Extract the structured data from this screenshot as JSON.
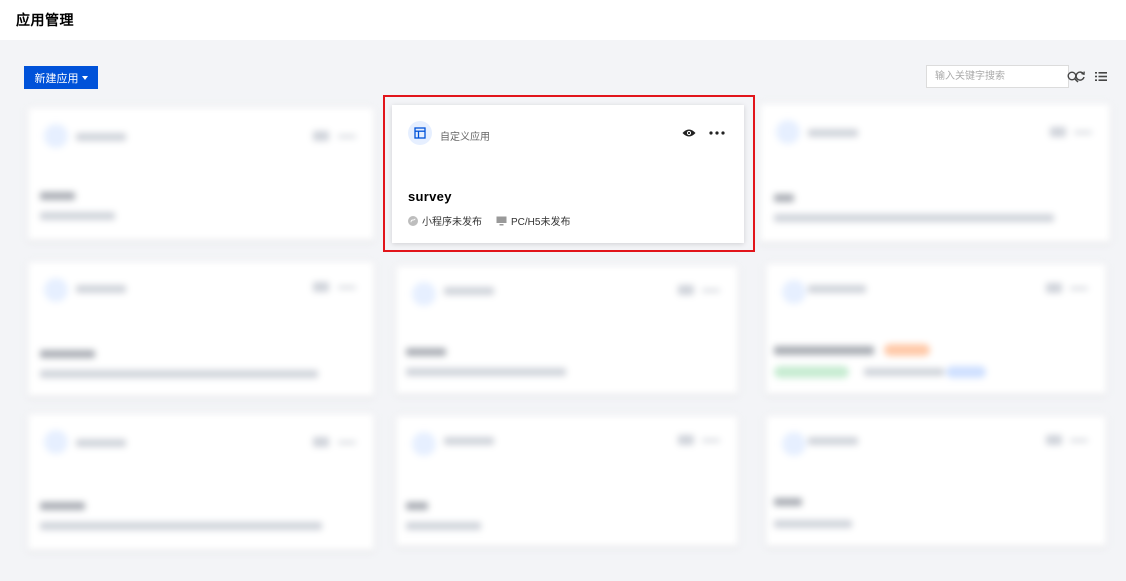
{
  "page": {
    "title": "应用管理"
  },
  "toolbar": {
    "new_app_label": "新建应用"
  },
  "search": {
    "placeholder": "输入关键字搜索"
  },
  "icons": {
    "search": "search-icon",
    "refresh": "refresh-icon",
    "list_view": "list-view-icon",
    "app": "app-layout-icon",
    "preview": "eye-icon",
    "more": "more-icon",
    "miniprogram": "miniprogram-icon",
    "pc": "monitor-icon"
  },
  "colors": {
    "primary": "#0052d9",
    "highlight": "#e2151b",
    "page_bg": "#f3f4f7"
  },
  "apps": [
    {
      "type_label": "自定义应用",
      "name": "survey",
      "statuses": [
        {
          "label": "小程序未发布"
        },
        {
          "label": "PC/H5未发布"
        }
      ]
    }
  ]
}
